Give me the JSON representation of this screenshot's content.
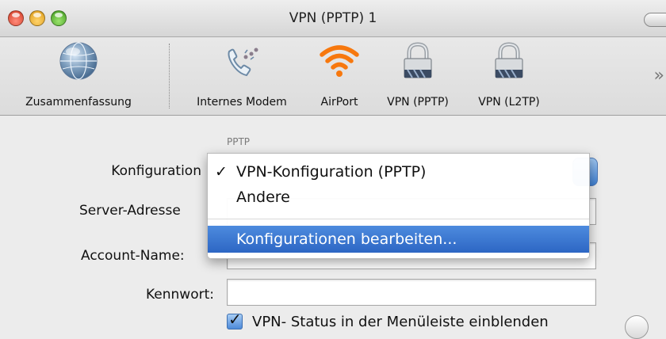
{
  "window": {
    "title": "VPN (PPTP) 1"
  },
  "toolbar": {
    "items": [
      {
        "label": "Zusammenfassung",
        "icon": "globe-icon"
      },
      {
        "label": "Internes Modem",
        "icon": "phone-modem-icon"
      },
      {
        "label": "AirPort",
        "icon": "airport-wifi-icon"
      },
      {
        "label": "VPN (PPTP)",
        "icon": "lock-icon"
      },
      {
        "label": "VPN (L2TP)",
        "icon": "lock-icon"
      }
    ],
    "overflow_glyph": "»"
  },
  "pane": {
    "section_label": "PPTP",
    "konfiguration_label": "Konfiguration",
    "server_label": "Server-Adresse",
    "account_label": "Account-Name:",
    "kennwort_label": "Kennwort:",
    "kennwort_value": "",
    "menu": {
      "items": [
        {
          "check": "✓",
          "label": "VPN-Konfiguration (PPTP)"
        },
        {
          "check": "",
          "label": "Andere"
        },
        {
          "check": "",
          "label": "Konfigurationen bearbeiten..."
        }
      ]
    },
    "status_checkbox": {
      "checked": true,
      "label": "VPN- Status in der Menüleiste einblenden"
    }
  },
  "colors": {
    "highlight": "#3b78d6",
    "airport": "#f7780e"
  }
}
